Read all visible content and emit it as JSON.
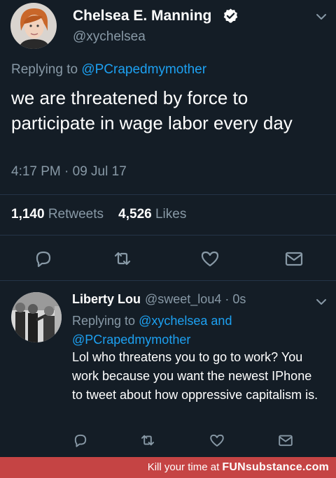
{
  "colors": {
    "background": "#141d26",
    "text_primary": "#ffffff",
    "text_secondary": "#8899a6",
    "link": "#1da1f2",
    "verified": "#ffffff",
    "watermark_bg": "#c54444"
  },
  "main_tweet": {
    "display_name": "Chelsea E. Manning",
    "handle": "@xychelsea",
    "verified_icon": "verified-badge-icon",
    "replying_prefix": "Replying to",
    "replying_to": "@PCrapedmymother",
    "text": "we are threatened by force to participate in wage labor every day",
    "timestamp": "4:17 PM · 09 Jul 17",
    "retweets_count": "1,140",
    "retweets_label": "Retweets",
    "likes_count": "4,526",
    "likes_label": "Likes",
    "actions": [
      "reply-icon",
      "retweet-icon",
      "like-icon",
      "direct-message-icon"
    ]
  },
  "reply_tweet": {
    "display_name": "Liberty Lou",
    "handle": "@sweet_lou4 · 0s",
    "replying_prefix": "Replying to",
    "replying_to_1": "@xychelsea",
    "replying_joiner": "and",
    "replying_to_2": "@PCrapedmymother",
    "text": "Lol who threatens you to go to work? You work because you want the newest IPhone to tweet about how oppressive capitalism is.",
    "actions": [
      "reply-icon",
      "retweet-icon",
      "like-icon",
      "direct-message-icon"
    ]
  },
  "watermark": {
    "prefix": "Kill your time at",
    "brand": "FUNsubstance.com"
  }
}
